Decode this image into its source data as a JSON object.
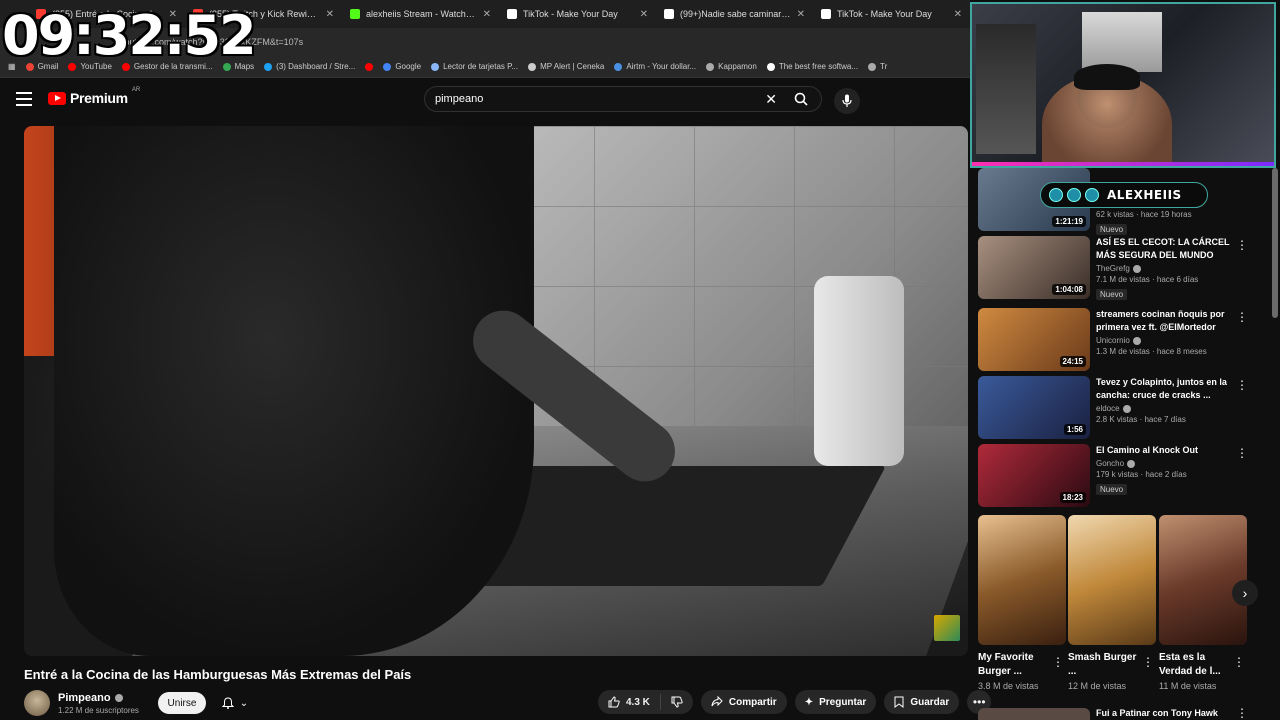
{
  "clock": "09:32:52",
  "browser": {
    "tabs": [
      {
        "label": "(855) Entré a la Cocina de las",
        "fav": "#ff3b30"
      },
      {
        "label": "(855) Twitch y Kick Rewind Arg",
        "fav": "#ff3b30"
      },
      {
        "label": "alexheiis Stream - Watch Live o",
        "fav": "#53fc18"
      },
      {
        "label": "TikTok - Make Your Day",
        "fav": "#ffffff"
      },
      {
        "label": "(99+)Nadie sabe caminar más c",
        "fav": "#ffffff"
      },
      {
        "label": "TikTok - Make Your Day",
        "fav": "#ffffff"
      }
    ],
    "url": "youtube.com/watch?v=...32Y6xKZFM&t=107s",
    "bookmarks": [
      {
        "label": "Gmail",
        "color": "#ea4335"
      },
      {
        "label": "YouTube",
        "color": "#ff0000"
      },
      {
        "label": "Gestor de la transmi...",
        "color": "#ff0000"
      },
      {
        "label": "Maps",
        "color": "#34a853"
      },
      {
        "label": "(3) Dashboard / Stre...",
        "color": "#1da1f2"
      },
      {
        "label": "",
        "color": "#ff0000"
      },
      {
        "label": "Google",
        "color": "#4285f4"
      },
      {
        "label": "Lector de tarjetas P...",
        "color": "#8ab4f8"
      },
      {
        "label": "MP Alert | Ceneka",
        "color": "#cccccc"
      },
      {
        "label": "Airtm - Your dollar...",
        "color": "#4a90e2"
      },
      {
        "label": "Kappamon",
        "color": "#aaaaaa"
      },
      {
        "label": "The best free softwa...",
        "color": "#ffffff"
      },
      {
        "label": "Tr",
        "color": "#aaaaaa"
      }
    ]
  },
  "header": {
    "logo_text": "Premium",
    "region": "AR",
    "search_value": "pimpeano"
  },
  "video": {
    "title": "Entré a la Cocina de las Hamburguesas Más Extremas del País",
    "channel": "Pimpeano",
    "subscribers": "1.22 M de suscriptores",
    "join_label": "Unirse",
    "likes": "4.3 K",
    "share_label": "Compartir",
    "ask_label": "Preguntar",
    "save_label": "Guardar"
  },
  "overlay": {
    "streamer_name": "ALEXHEIIS"
  },
  "recommendations": [
    {
      "title": "...",
      "channel": "",
      "meta": "62 k vistas · hace 19 horas",
      "badge": "Nuevo",
      "duration": "1:21:19",
      "thumb": "#4a5a6e"
    },
    {
      "title": "ASÍ ES EL CECOT: LA CÁRCEL MÁS SEGURA DEL MUNDO",
      "channel": "TheGrefg",
      "meta": "7.1 M de vistas · hace 6 días",
      "badge": "Nuevo",
      "duration": "1:04:08",
      "thumb": "#7a6b5a"
    },
    {
      "title": "streamers cocinan ñoquis por primera vez ft. @ElMortedor",
      "channel": "Unicornio",
      "meta": "1.3 M de vistas · hace 8 meses",
      "badge": "",
      "duration": "24:15",
      "thumb": "#a05a2c"
    },
    {
      "title": "Tevez y Colapinto, juntos en la cancha: cruce de cracks ...",
      "channel": "eldoce",
      "meta": "2.8 K vistas · hace 7 días",
      "badge": "",
      "duration": "1:56",
      "thumb": "#233a6a"
    },
    {
      "title": "El Camino al Knock Out",
      "channel": "Goncho",
      "meta": "179 k vistas · hace 2 días",
      "badge": "Nuevo",
      "duration": "18:23",
      "thumb": "#8a1a2a"
    }
  ],
  "shorts": [
    {
      "title": "My Favorite Burger ...",
      "views": "3.8 M de vistas",
      "thumb": "#8a5a2a"
    },
    {
      "title": "Smash Burger ...",
      "views": "12 M de vistas",
      "thumb": "#b07a30"
    },
    {
      "title": "Esta es la Verdad de l...",
      "views": "11 M de vistas",
      "thumb": "#6a3a2a"
    }
  ],
  "last_rec": {
    "title": "Fui a Patinar con Tony Hawk"
  }
}
